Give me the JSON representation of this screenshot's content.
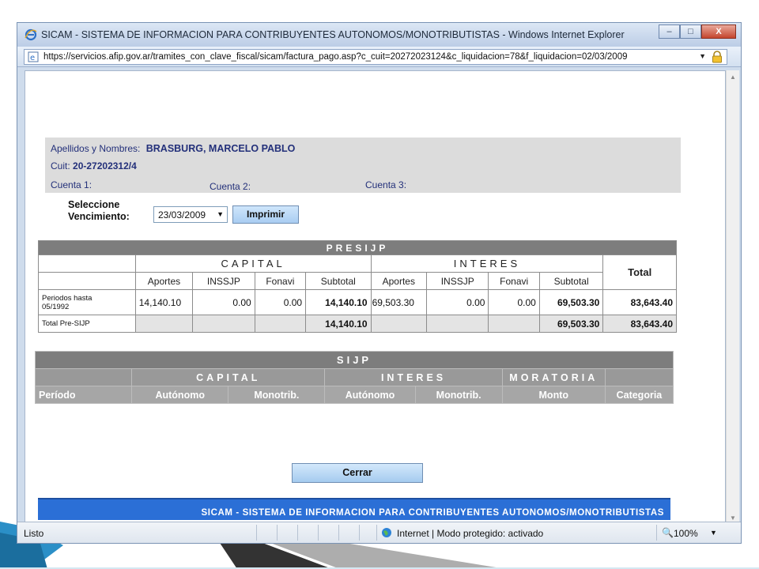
{
  "window": {
    "title": "SICAM - SISTEMA DE INFORMACION PARA CONTRIBUYENTES AUTONOMOS/MONOTRIBUTISTAS - Windows Internet Explorer",
    "url": "https://servicios.afip.gov.ar/tramites_con_clave_fiscal/sicam/factura_pago.asp?c_cuit=20272023124&c_liquidacion=78&f_liquidacion=02/03/2009",
    "minimize_glyph": "–",
    "maximize_glyph": "□",
    "close_glyph": "X"
  },
  "contribuyente": {
    "nombres_label": "Apellidos y Nombres:",
    "nombres_value": "BRASBURG, MARCELO PABLO",
    "cuit_label": "Cuit:",
    "cuit_value": "20-27202312/4",
    "cuenta1_label": "Cuenta 1:",
    "cuenta2_label": "Cuenta 2:",
    "cuenta3_label": "Cuenta 3:"
  },
  "vencimiento": {
    "label_line1": "Seleccione",
    "label_line2": "Vencimiento:",
    "selected": "23/03/2009",
    "print_button": "Imprimir"
  },
  "presijp": {
    "section": "PRESIJP",
    "capital": "CAPITAL",
    "intereses": "INTERES",
    "total": "Total",
    "columns": [
      "Aportes",
      "INSSJP",
      "Fonavi",
      "Subtotal",
      "Aportes",
      "INSSJP",
      "Fonavi",
      "Subtotal"
    ],
    "row1": {
      "label_line1": "Periodos hasta",
      "label_line2": "05/1992",
      "values": [
        "14,140.10",
        "0.00",
        "0.00",
        "14,140.10",
        "69,503.30",
        "0.00",
        "0.00",
        "69,503.30"
      ],
      "total": "83,643.40"
    },
    "row2": {
      "label": "Total Pre-SIJP",
      "capital_subtotal": "14,140.10",
      "interes_subtotal": "69,503.30",
      "total": "83,643.40"
    }
  },
  "sijp": {
    "section": "SIJP",
    "capital": "CAPITAL",
    "intereses": "INTERES",
    "moratoria": "MORATORIA",
    "columns": [
      "Período",
      "Autónomo",
      "Monotrib.",
      "Autónomo",
      "Monotrib.",
      "Monto",
      "Categoria"
    ]
  },
  "close_button": "Cerrar",
  "footer": "SICAM - SISTEMA DE INFORMACION PARA CONTRIBUYENTES AUTONOMOS/MONOTRIBUTISTAS",
  "status": {
    "left": "Listo",
    "zone": "Internet | Modo protegido: activado",
    "zoom": "100%"
  }
}
